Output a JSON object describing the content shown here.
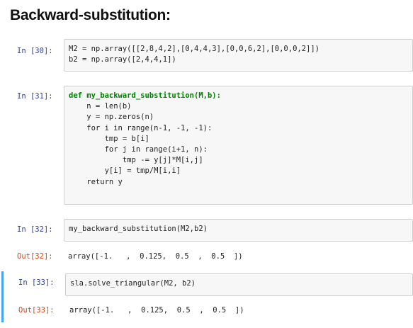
{
  "heading": "Backward-substitution:",
  "cells": [
    {
      "in_prompt": "In [30]:",
      "code_lines": [
        "M2 = np.array([[2,8,4,2],[0,4,4,3],[0,0,6,2],[0,0,0,2]])",
        "b2 = np.array([2,4,4,1])"
      ]
    },
    {
      "in_prompt": "In [31]:",
      "code_lines": [
        "def my_backward_substitution(M,b):",
        "    n = len(b)",
        "    y = np.zeros(n)",
        "    for i in range(n-1, -1, -1):",
        "        tmp = b[i]",
        "        for j in range(i+1, n):",
        "            tmp -= y[j]*M[i,j]",
        "        y[i] = tmp/M[i,i]",
        "    return y"
      ]
    },
    {
      "in_prompt": "In [32]:",
      "code_lines": [
        "my_backward_substitution(M2,b2)"
      ],
      "out_prompt": "Out[32]:",
      "output": "array([-1.   ,  0.125,  0.5  ,  0.5  ])"
    },
    {
      "in_prompt": "In [33]:",
      "code_lines": [
        "sla.solve_triangular(M2, b2)"
      ],
      "out_prompt": "Out[33]:",
      "output": "array([-1.   ,  0.125,  0.5  ,  0.5  ])"
    }
  ],
  "colors": {
    "in_prompt": "#303f9f",
    "out_prompt": "#d84315",
    "selected_border": "#42a5f5",
    "keyword": "#008000",
    "function_name": "#1565c0"
  }
}
